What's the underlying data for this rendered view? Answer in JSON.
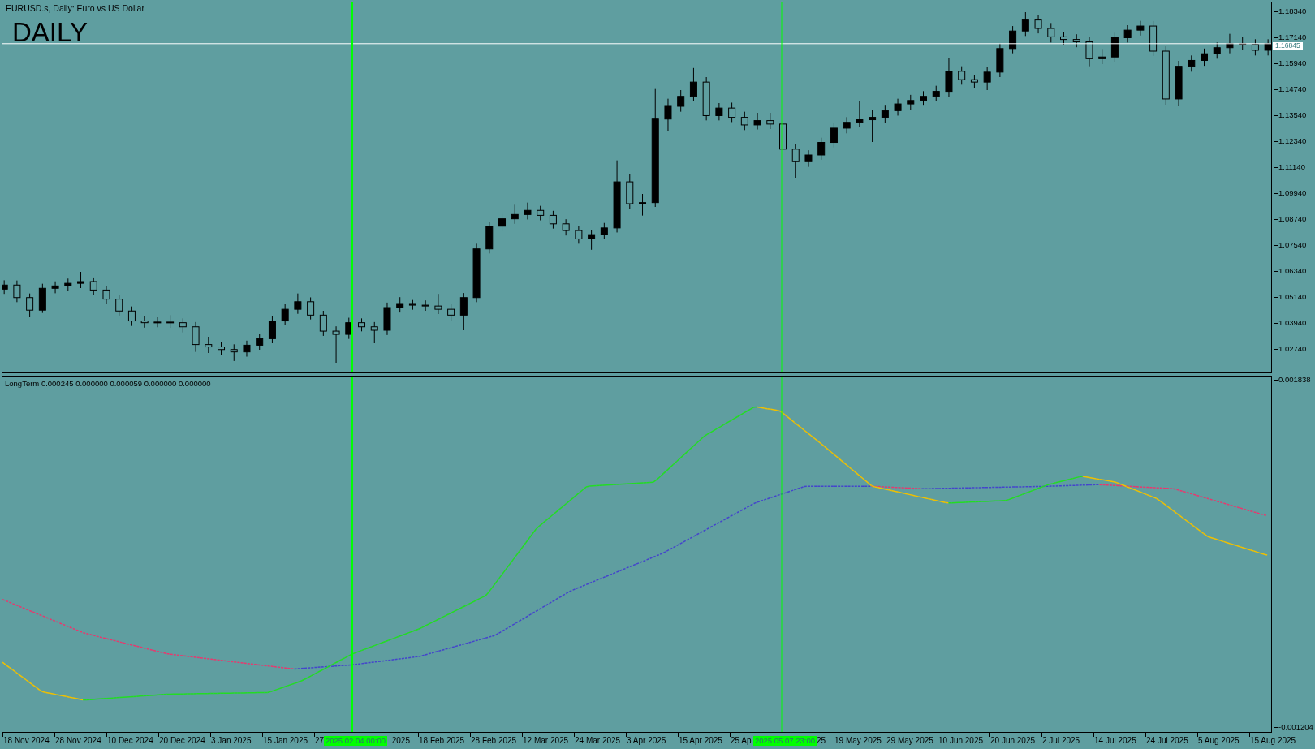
{
  "chart": {
    "title": "EURUSD.s, Daily:  Euro vs US Dollar",
    "timeframe_label": "DAILY"
  },
  "price_axis": {
    "chart_data": {
      "type": "candlestick",
      "ylim": [
        1.0165,
        1.1875
      ],
      "ref_lines": [
        {
          "axis": "y",
          "value": 1.16845,
          "label": "1.16845"
        }
      ],
      "yticks": [
        {
          "value": 1.1834,
          "label": "1.18340"
        },
        {
          "value": 1.1714,
          "label": "1.17140"
        },
        {
          "value": 1.1594,
          "label": "1.15940"
        },
        {
          "value": 1.1474,
          "label": "1.14740"
        },
        {
          "value": 1.1354,
          "label": "1.13540"
        },
        {
          "value": 1.1234,
          "label": "1.12340"
        },
        {
          "value": 1.1114,
          "label": "1.11140"
        },
        {
          "value": 1.0994,
          "label": "1.09940"
        },
        {
          "value": 1.0874,
          "label": "1.08740"
        },
        {
          "value": 1.0754,
          "label": "1.07540"
        },
        {
          "value": 1.0634,
          "label": "1.06340"
        },
        {
          "value": 1.0514,
          "label": "1.05140"
        },
        {
          "value": 1.0394,
          "label": "1.03940"
        },
        {
          "value": 1.0274,
          "label": "1.02740"
        }
      ],
      "ohlc": [
        [
          1.055,
          1.0591,
          1.0528,
          1.0569
        ],
        [
          1.0569,
          1.059,
          1.049,
          1.0511
        ],
        [
          1.0511,
          1.053,
          1.042,
          1.0453
        ],
        [
          1.0453,
          1.0575,
          1.044,
          1.0554
        ],
        [
          1.0554,
          1.0586,
          1.0531,
          1.0565
        ],
        [
          1.0565,
          1.0599,
          1.0543,
          1.0577
        ],
        [
          1.0577,
          1.063,
          1.0555,
          1.0585
        ],
        [
          1.0585,
          1.0604,
          1.0525,
          1.0546
        ],
        [
          1.0546,
          1.0566,
          1.048,
          1.0504
        ],
        [
          1.0504,
          1.0525,
          1.0428,
          1.0449
        ],
        [
          1.0449,
          1.047,
          1.038,
          1.0403
        ],
        [
          1.0403,
          1.0424,
          1.0372,
          1.0395
        ],
        [
          1.0395,
          1.042,
          1.0374,
          1.0398
        ],
        [
          1.0398,
          1.043,
          1.0371,
          1.0395
        ],
        [
          1.0395,
          1.0415,
          1.035,
          1.0376
        ],
        [
          1.0376,
          1.0398,
          1.026,
          1.0294
        ],
        [
          1.0294,
          1.033,
          1.0255,
          1.0283
        ],
        [
          1.0283,
          1.0305,
          1.0245,
          1.0271
        ],
        [
          1.0271,
          1.0295,
          1.0218,
          1.026
        ],
        [
          1.026,
          1.0312,
          1.0238,
          1.0291
        ],
        [
          1.0291,
          1.0343,
          1.027,
          1.0321
        ],
        [
          1.0321,
          1.0425,
          1.03,
          1.0403
        ],
        [
          1.0403,
          1.048,
          1.0385,
          1.0457
        ],
        [
          1.0457,
          1.053,
          1.0436,
          1.0492
        ],
        [
          1.0492,
          1.0512,
          1.041,
          1.043
        ],
        [
          1.043,
          1.045,
          1.0334,
          1.0356
        ],
        [
          1.0356,
          1.0378,
          1.021,
          1.0341
        ],
        [
          1.0341,
          1.0418,
          1.032,
          1.0395
        ],
        [
          1.0395,
          1.0415,
          1.0355,
          1.0376
        ],
        [
          1.0376,
          1.0398,
          1.03,
          1.036
        ],
        [
          1.036,
          1.0488,
          1.0338,
          1.0465
        ],
        [
          1.0465,
          1.0513,
          1.0442,
          1.048
        ],
        [
          1.048,
          1.05,
          1.0455,
          1.0476
        ],
        [
          1.0476,
          1.0498,
          1.045,
          1.0472
        ],
        [
          1.0472,
          1.0528,
          1.0435,
          1.0457
        ],
        [
          1.0457,
          1.048,
          1.0405,
          1.043
        ],
        [
          1.043,
          1.0532,
          1.036,
          1.0511
        ],
        [
          1.0511,
          1.076,
          1.049,
          1.0736
        ],
        [
          1.0736,
          1.0862,
          1.0715,
          1.0841
        ],
        [
          1.0841,
          1.0898,
          1.0818,
          1.0875
        ],
        [
          1.0875,
          1.094,
          1.0852,
          1.0895
        ],
        [
          1.0895,
          1.095,
          1.0872,
          1.0914
        ],
        [
          1.0914,
          1.0935,
          1.0868,
          1.0891
        ],
        [
          1.0891,
          1.0912,
          1.083,
          1.0852
        ],
        [
          1.0852,
          1.0873,
          1.0798,
          1.0821
        ],
        [
          1.0821,
          1.0843,
          1.076,
          1.0782
        ],
        [
          1.0782,
          1.0825,
          1.0732,
          1.0802
        ],
        [
          1.0802,
          1.0856,
          1.078,
          1.0833
        ],
        [
          1.0833,
          1.1145,
          1.0812,
          1.1046
        ],
        [
          1.1046,
          1.108,
          1.092,
          1.0945
        ],
        [
          1.0945,
          1.099,
          1.089,
          1.095
        ],
        [
          1.095,
          1.1475,
          1.093,
          1.1336
        ],
        [
          1.1336,
          1.143,
          1.128,
          1.1395
        ],
        [
          1.1395,
          1.147,
          1.137,
          1.1441
        ],
        [
          1.1441,
          1.1572,
          1.142,
          1.1507
        ],
        [
          1.1507,
          1.153,
          1.133,
          1.1352
        ],
        [
          1.1352,
          1.141,
          1.133,
          1.1387
        ],
        [
          1.1387,
          1.1412,
          1.1322,
          1.1344
        ],
        [
          1.1344,
          1.137,
          1.1285,
          1.1309
        ],
        [
          1.1309,
          1.1365,
          1.1288,
          1.1329
        ],
        [
          1.1329,
          1.1365,
          1.129,
          1.1313
        ],
        [
          1.1313,
          1.1335,
          1.1175,
          1.1197
        ],
        [
          1.1197,
          1.122,
          1.1065,
          1.1139
        ],
        [
          1.1139,
          1.1192,
          1.1115,
          1.117
        ],
        [
          1.117,
          1.125,
          1.1148,
          1.1228
        ],
        [
          1.1228,
          1.1318,
          1.1205,
          1.1294
        ],
        [
          1.1294,
          1.1345,
          1.127,
          1.1321
        ],
        [
          1.1321,
          1.142,
          1.13,
          1.1333
        ],
        [
          1.1333,
          1.138,
          1.123,
          1.1344
        ],
        [
          1.1344,
          1.1398,
          1.132,
          1.1375
        ],
        [
          1.1375,
          1.143,
          1.1352,
          1.1406
        ],
        [
          1.1406,
          1.1448,
          1.138,
          1.1422
        ],
        [
          1.1422,
          1.1465,
          1.1398,
          1.1441
        ],
        [
          1.1441,
          1.149,
          1.1418,
          1.1464
        ],
        [
          1.1464,
          1.162,
          1.144,
          1.1557
        ],
        [
          1.1557,
          1.158,
          1.1495,
          1.1518
        ],
        [
          1.1518,
          1.154,
          1.148,
          1.1507
        ],
        [
          1.1507,
          1.1578,
          1.147,
          1.1553
        ],
        [
          1.1553,
          1.1685,
          1.153,
          1.1662
        ],
        [
          1.1662,
          1.1766,
          1.164,
          1.1743
        ],
        [
          1.1743,
          1.183,
          1.172,
          1.1794
        ],
        [
          1.1794,
          1.1818,
          1.1732,
          1.1755
        ],
        [
          1.1755,
          1.178,
          1.169,
          1.1716
        ],
        [
          1.1716,
          1.174,
          1.168,
          1.1704
        ],
        [
          1.1704,
          1.1728,
          1.1668,
          1.1693
        ],
        [
          1.1693,
          1.1716,
          1.158,
          1.1615
        ],
        [
          1.1615,
          1.166,
          1.159,
          1.1623
        ],
        [
          1.1623,
          1.1735,
          1.16,
          1.1712
        ],
        [
          1.1712,
          1.177,
          1.169,
          1.1747
        ],
        [
          1.1747,
          1.179,
          1.1722,
          1.1766
        ],
        [
          1.1766,
          1.1789,
          1.1628,
          1.165
        ],
        [
          1.165,
          1.1672,
          1.14,
          1.1429
        ],
        [
          1.1429,
          1.1605,
          1.1395,
          1.158
        ],
        [
          1.158,
          1.163,
          1.1555,
          1.1607
        ],
        [
          1.1607,
          1.1662,
          1.1582,
          1.1638
        ],
        [
          1.1638,
          1.169,
          1.1615,
          1.1666
        ],
        [
          1.1666,
          1.173,
          1.164,
          1.1685
        ],
        [
          1.1685,
          1.1715,
          1.1655,
          1.1681
        ],
        [
          1.1681,
          1.1705,
          1.163,
          1.1654
        ],
        [
          1.1654,
          1.1705,
          1.163,
          1.1685
        ]
      ]
    }
  },
  "indicator": {
    "legend": "LongTerm 0.000245 0.000000 0.000059 0.000000 0.000000",
    "axis_labels": [
      "0.001838",
      "-0.001204"
    ]
  },
  "time_axis": {
    "labels": [
      {
        "text": "18 Nov 2024",
        "kind": "tick"
      },
      {
        "text": "28 Nov 2024",
        "kind": "tick"
      },
      {
        "text": "10 Dec 2024",
        "kind": "tick"
      },
      {
        "text": "20 Dec 2024",
        "kind": "tick"
      },
      {
        "text": "3 Jan 2025",
        "kind": "tick"
      },
      {
        "text": "15 Jan 2025",
        "kind": "tick"
      },
      {
        "text": "27",
        "kind": "tick"
      },
      {
        "text": "2025",
        "kind": "tail"
      },
      {
        "text": "18 Feb 2025",
        "kind": "tick"
      },
      {
        "text": "28 Feb 2025",
        "kind": "tick"
      },
      {
        "text": "12 Mar 2025",
        "kind": "tick"
      },
      {
        "text": "24 Mar 2025",
        "kind": "tick"
      },
      {
        "text": "3 Apr 2025",
        "kind": "tick"
      },
      {
        "text": "15 Apr 2025",
        "kind": "tick"
      },
      {
        "text": "25 Ap",
        "kind": "tick"
      },
      {
        "text": "25",
        "kind": "tail"
      },
      {
        "text": "19 May 2025",
        "kind": "tick"
      },
      {
        "text": "29 May 2025",
        "kind": "tick"
      },
      {
        "text": "10 Jun 2025",
        "kind": "tick"
      },
      {
        "text": "20 Jun 2025",
        "kind": "tick"
      },
      {
        "text": "2 Jul 2025",
        "kind": "tick"
      },
      {
        "text": "14 Jul 2025",
        "kind": "tick"
      },
      {
        "text": "24 Jul 2025",
        "kind": "tick"
      },
      {
        "text": "5 Aug 2025",
        "kind": "tick"
      },
      {
        "text": "15 Aug 2025",
        "kind": "tick"
      }
    ],
    "crosshair_tags": [
      "2025.02.04 00:00",
      "2025.05.07 23:00"
    ]
  }
}
